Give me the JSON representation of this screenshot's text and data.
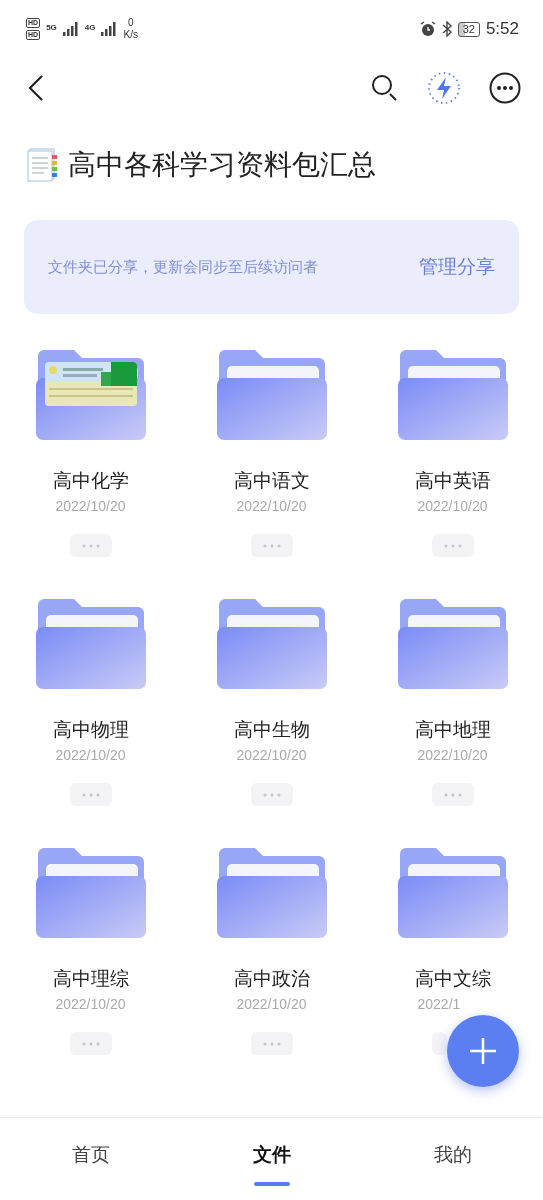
{
  "status_bar": {
    "sim_labels": [
      "HD",
      "HD"
    ],
    "networks": [
      "5G",
      "4G"
    ],
    "speed": "0",
    "speed_unit": "K/s",
    "battery": "32",
    "time": "5:52"
  },
  "title": "高中各科学习资料包汇总",
  "share_banner": {
    "message": "文件夹已分享，更新会同步至后续访问者",
    "action": "管理分享"
  },
  "folders": [
    {
      "name": "高中化学",
      "date": "2022/10/20",
      "kind": "thumbnail"
    },
    {
      "name": "高中语文",
      "date": "2022/10/20",
      "kind": "plain"
    },
    {
      "name": "高中英语",
      "date": "2022/10/20",
      "kind": "plain"
    },
    {
      "name": "高中物理",
      "date": "2022/10/20",
      "kind": "plain"
    },
    {
      "name": "高中生物",
      "date": "2022/10/20",
      "kind": "plain"
    },
    {
      "name": "高中地理",
      "date": "2022/10/20",
      "kind": "plain"
    },
    {
      "name": "高中理综",
      "date": "2022/10/20",
      "kind": "plain"
    },
    {
      "name": "高中政治",
      "date": "2022/10/20",
      "kind": "plain"
    },
    {
      "name": "高中文综",
      "date": "2022/1",
      "kind": "plain"
    }
  ],
  "bottom_tabs": [
    {
      "label": "首页",
      "selected": false
    },
    {
      "label": "文件",
      "selected": true
    },
    {
      "label": "我的",
      "selected": false
    }
  ]
}
